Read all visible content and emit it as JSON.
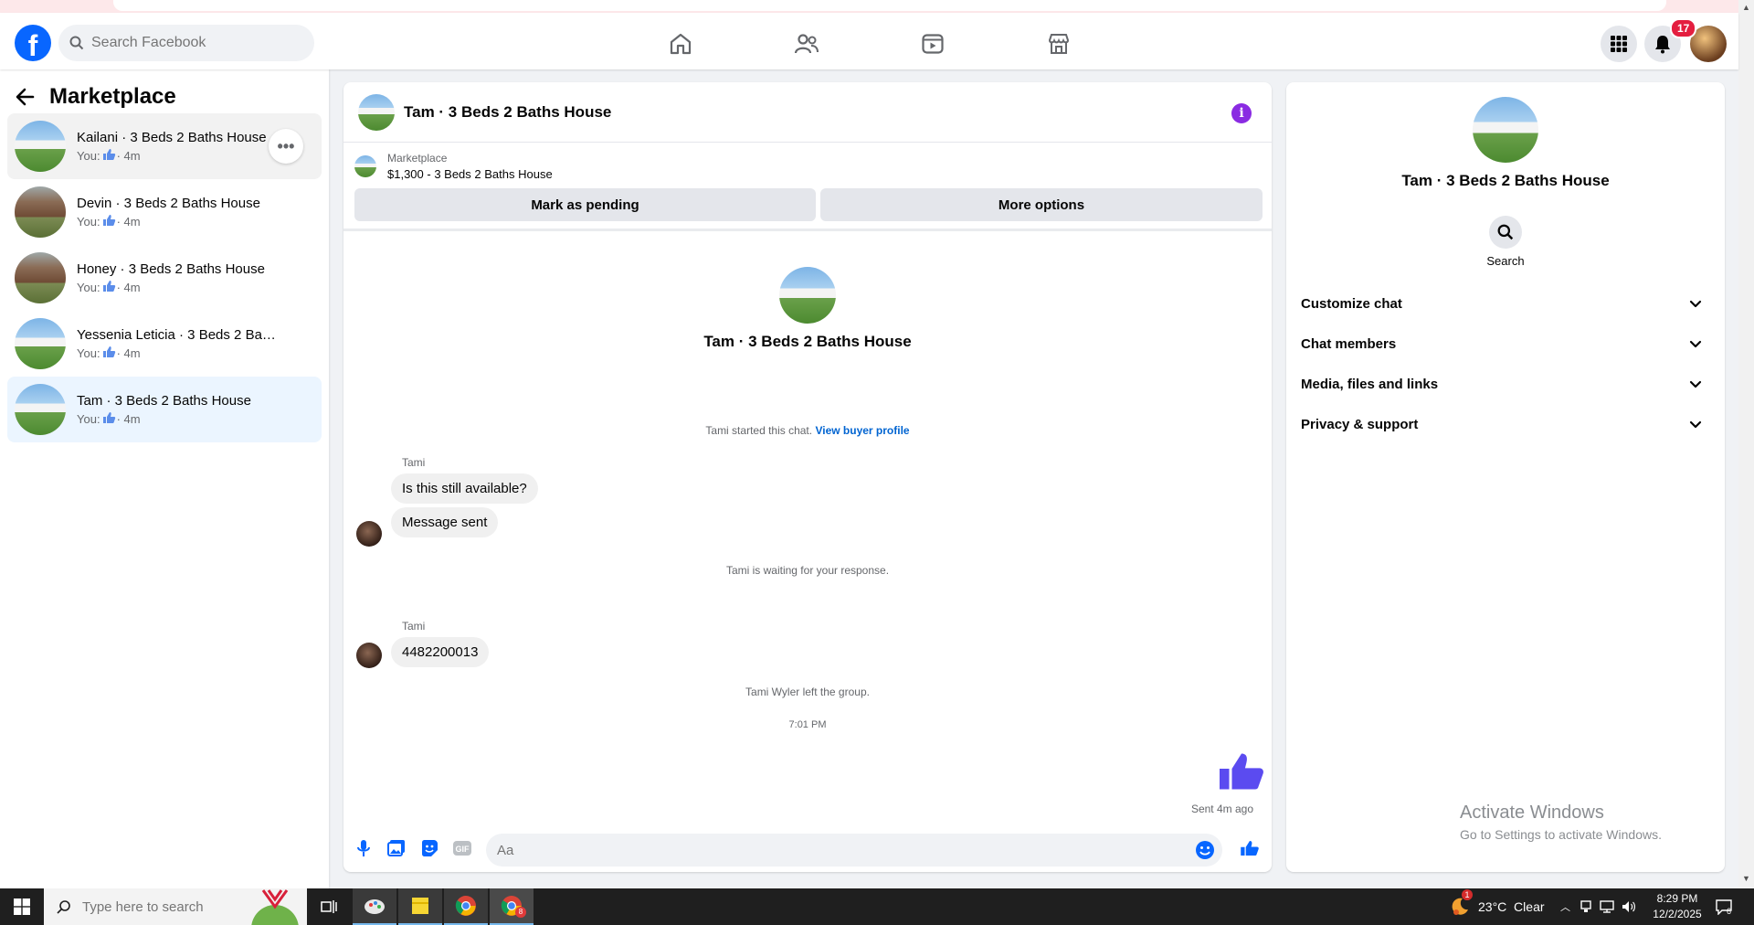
{
  "topbar": {
    "search_placeholder": "Search Facebook",
    "notification_count": "17"
  },
  "sidebar": {
    "title": "Marketplace",
    "conversations": [
      {
        "title": "Kailani · 3 Beds 2 Baths House",
        "prefix": "You:",
        "time": "· 4m"
      },
      {
        "title": "Devin · 3 Beds 2 Baths House",
        "prefix": "You:",
        "time": "· 4m"
      },
      {
        "title": "Honey · 3 Beds 2 Baths House",
        "prefix": "You:",
        "time": "· 4m"
      },
      {
        "title": "Yessenia Leticia · 3 Beds 2 Baths H...",
        "prefix": "You:",
        "time": "· 4m"
      },
      {
        "title": "Tam · 3 Beds 2 Baths House",
        "prefix": "You:",
        "time": "· 4m"
      }
    ]
  },
  "chat": {
    "title": "Tam · 3 Beds 2 Baths House",
    "listing_source": "Marketplace",
    "listing_info": "$1,300 - 3 Beds 2 Baths House",
    "mark_pending": "Mark as pending",
    "more_options": "More options",
    "profile_name": "Tam · 3 Beds 2 Baths House",
    "started_text": "Tami started this chat.",
    "view_profile": "View buyer profile",
    "sender1": "Tami",
    "msg1": "Is this still available?",
    "msg2": "Message sent",
    "waiting": "Tami is waiting for your response.",
    "sender2": "Tami",
    "msg3": "4482200013",
    "left_group": "Tami Wyler left the group.",
    "timestamp": "7:01 PM",
    "sent_status": "Sent 4m ago",
    "input_placeholder": "Aa"
  },
  "right_panel": {
    "name": "Tam · 3 Beds 2 Baths House",
    "search_label": "Search",
    "sections": [
      "Customize chat",
      "Chat members",
      "Media, files and links",
      "Privacy & support"
    ]
  },
  "watermark": {
    "line1": "Activate Windows",
    "line2": "Go to Settings to activate Windows."
  },
  "taskbar": {
    "search_placeholder": "Type here to search",
    "weather_badge": "1",
    "weather": "23°C  Clear",
    "time": "8:29 PM",
    "date": "12/2/2025",
    "chrome_badge": "8"
  },
  "colors": {
    "facebook_blue": "#0866ff",
    "like_purple": "#5b4bf0",
    "selected_bg": "#ebf5ff",
    "info_purple": "#8a2be2"
  }
}
